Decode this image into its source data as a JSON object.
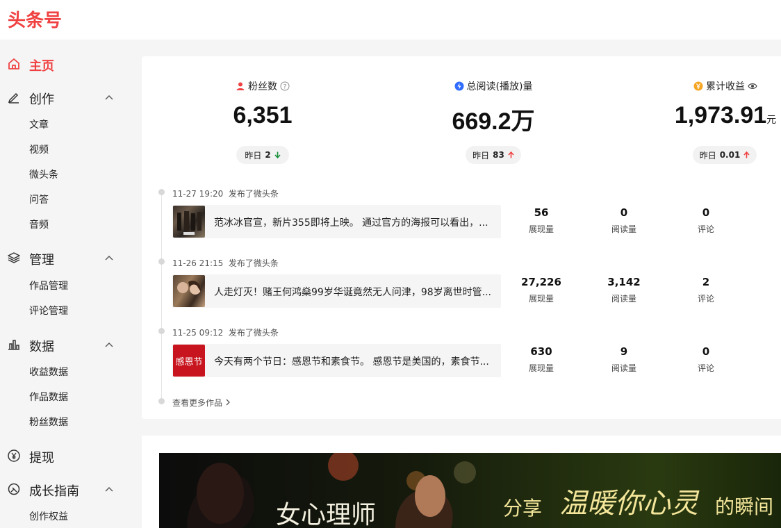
{
  "brand": {
    "logo_text": "头条号",
    "color": "#f04142"
  },
  "sidebar": {
    "home": {
      "label": "主页",
      "icon": "home-icon"
    },
    "create": {
      "label": "创作",
      "icon": "pencil-icon",
      "items": [
        "文章",
        "视频",
        "微头条",
        "问答",
        "音频"
      ]
    },
    "manage": {
      "label": "管理",
      "icon": "layers-icon",
      "items": [
        "作品管理",
        "评论管理"
      ]
    },
    "data": {
      "label": "数据",
      "icon": "bar-chart-icon",
      "items": [
        "收益数据",
        "作品数据",
        "粉丝数据"
      ]
    },
    "withdraw": {
      "label": "提现",
      "icon": "yuan-icon"
    },
    "growth": {
      "label": "成长指南",
      "icon": "compass-icon",
      "items": [
        "创作权益"
      ]
    }
  },
  "stats": {
    "fans": {
      "label": "粉丝数",
      "value": "6,351",
      "yesterday_label": "昨日",
      "yesterday_value": "2",
      "trend": "down",
      "icon": "user-icon"
    },
    "reads": {
      "label": "总阅读(播放)量",
      "value": "669.2万",
      "yesterday_label": "昨日",
      "yesterday_value": "83",
      "trend": "up",
      "icon": "read-icon"
    },
    "income": {
      "label": "累计收益",
      "value": "1,973.91",
      "unit": "元",
      "yesterday_label": "昨日",
      "yesterday_value": "0.01",
      "trend": "up",
      "icon": "coin-icon"
    }
  },
  "posts": [
    {
      "date": "11-27 19:20",
      "action": "发布了微头条",
      "text": "范冰冰官宣，新片355即将上映。 通过官方的海报可以看出，...",
      "impressions": "56",
      "reads": "0",
      "comments": "0"
    },
    {
      "date": "11-26 21:15",
      "action": "发布了微头条",
      "text": "人走灯灭！赌王何鸿燊99岁华诞竟然无人问津，98岁离世时管...",
      "impressions": "27,226",
      "reads": "3,142",
      "comments": "2"
    },
    {
      "date": "11-25 09:12",
      "action": "发布了微头条",
      "text": "今天有两个节日：感恩节和素食节。 感恩节是美国的，素食节...",
      "impressions": "630",
      "reads": "9",
      "comments": "0"
    }
  ],
  "metric_labels": {
    "impressions": "展现量",
    "reads": "阅读量",
    "comments": "评论"
  },
  "more_link": "查看更多作品",
  "thumb3_text": "感恩节",
  "banner": {
    "t1": "女心理师",
    "t2": "分享",
    "t3": "温暖你心灵",
    "t4": "的瞬间"
  },
  "colors": {
    "up": "#f04142",
    "down": "#1a8f3c",
    "read_icon": "#2f6bff",
    "coin_icon": "#f5a623"
  }
}
